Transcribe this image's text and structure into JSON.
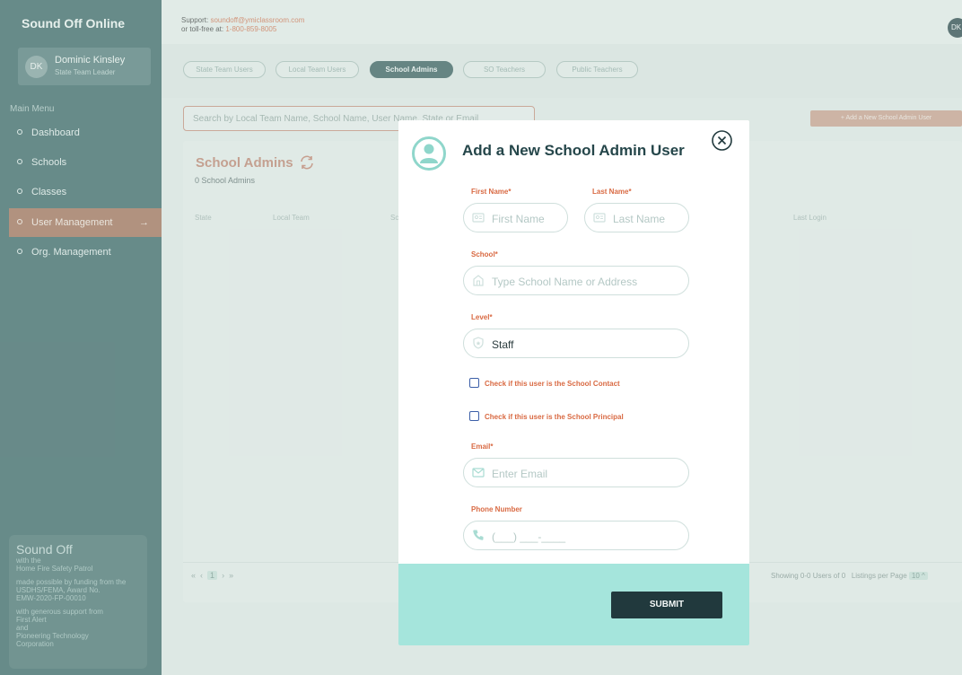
{
  "app": {
    "brand": "Sound Off Online"
  },
  "support": {
    "line1_prefix": "Support: ",
    "email": "soundoff@ymiclassroom.com",
    "line2_prefix": "or toll-free at: ",
    "phone": "1-800-859-8005",
    "corner_initials": "DK"
  },
  "user": {
    "initials": "DK",
    "name": "Dominic Kinsley",
    "role": "State Team Leader"
  },
  "menu": {
    "title": "Main Menu",
    "items": [
      {
        "label": "Dashboard",
        "active": false
      },
      {
        "label": "Schools",
        "active": false
      },
      {
        "label": "Classes",
        "active": false
      },
      {
        "label": "User Management",
        "active": true
      },
      {
        "label": "Org. Management",
        "active": false
      }
    ],
    "arrow": "→"
  },
  "footer": {
    "title": "Sound Off",
    "l1": "with the",
    "l2": "Home Fire Safety Patrol",
    "l3": "made possible by funding from the",
    "l4": "USDHS/FEMA, Award No.",
    "l5": "EMW-2020-FP-00010",
    "l6": "with generous support from",
    "l7": "First Alert",
    "l8": "and",
    "l9": "Pioneering Technology",
    "l10": "Corporation"
  },
  "tabs": [
    "State Team Users",
    "Local Team Users",
    "School Admins",
    "SO Teachers",
    "Public Teachers"
  ],
  "search": {
    "placeholder": "Search by Local Team Name, School Name, User Name, State or Email"
  },
  "add_button": "+ Add a New School Admin User",
  "panel": {
    "title": "School Admins",
    "count": "0 School Admins",
    "columns": [
      "State",
      "Local Team",
      "Sc",
      "Last Login"
    ]
  },
  "pagination": {
    "first": "«",
    "prev": "‹",
    "current": "1",
    "next": "›",
    "last": "»",
    "showing": "Showing 0-0 Users of 0",
    "per_page_label": "Listings per Page",
    "per_page_value": "10",
    "per_page_caret": "^"
  },
  "modal": {
    "title": "Add a New School Admin User",
    "first_name_label": "First Name*",
    "first_name_placeholder": "First Name",
    "last_name_label": "Last Name*",
    "last_name_placeholder": "Last Name",
    "school_label": "School*",
    "school_placeholder": "Type School Name or Address",
    "level_label": "Level*",
    "level_value": "Staff",
    "contact_checkbox": "Check if this user is the School Contact",
    "principal_checkbox": "Check if this user is the School Principal",
    "email_label": "Email*",
    "email_placeholder": "Enter Email",
    "phone_label": "Phone Number",
    "phone_placeholder": "(___) ___-____",
    "submit": "SUBMIT"
  },
  "colors": {
    "sidebar": "#2f5c5c",
    "accent": "#d96a43",
    "modal_footer": "#a5e5dc",
    "submit": "#21393d"
  }
}
